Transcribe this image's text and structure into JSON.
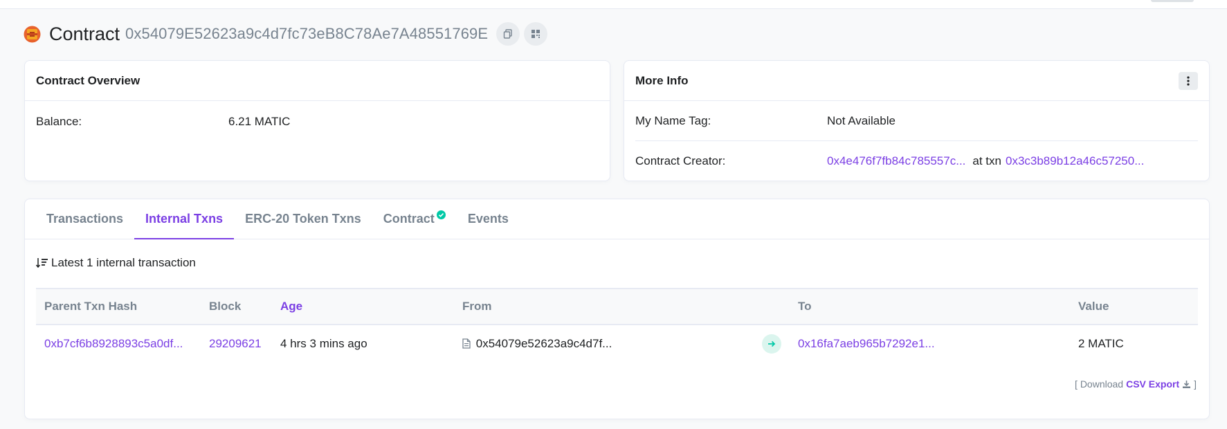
{
  "header": {
    "title": "Contract",
    "address": "0x54079E52623a9c4d7fc73eB8C78Ae7A48551769E"
  },
  "overview": {
    "title": "Contract Overview",
    "balance_label": "Balance:",
    "balance_value": "6.21 MATIC"
  },
  "more_info": {
    "title": "More Info",
    "name_tag_label": "My Name Tag:",
    "name_tag_value": "Not Available",
    "creator_label": "Contract Creator:",
    "creator_address": "0x4e476f7fb84c785557c...",
    "at_txn_label": "at txn",
    "creator_txn": "0x3c3b89b12a46c57250..."
  },
  "tabs": [
    {
      "label": "Transactions",
      "active": false
    },
    {
      "label": "Internal Txns",
      "active": true
    },
    {
      "label": "ERC-20 Token Txns",
      "active": false
    },
    {
      "label": "Contract",
      "active": false,
      "verified": true
    },
    {
      "label": "Events",
      "active": false
    }
  ],
  "internal_txns": {
    "summary": "Latest 1 internal transaction",
    "columns": [
      "Parent Txn Hash",
      "Block",
      "Age",
      "From",
      "To",
      "Value"
    ],
    "rows": [
      {
        "parent_hash": "0xb7cf6b8928893c5a0df...",
        "block": "29209621",
        "age": "4 hrs 3 mins ago",
        "from": "0x54079e52623a9c4d7f...",
        "to": "0x16fa7aeb965b7292e1...",
        "value": "2 MATIC"
      }
    ],
    "download_prefix": "[ Download",
    "csv_label": "CSV Export",
    "download_suffix": "]"
  },
  "colors": {
    "accent": "#7b3fe4",
    "muted": "#77838f",
    "success": "#00c9a7"
  },
  "icons": {
    "logo": "contract-token-icon",
    "copy": "copy-icon",
    "qr": "qr-code-icon",
    "kebab": "kebab-menu-icon",
    "verified": "check-circle-icon",
    "sort": "sort-descending-icon",
    "file": "file-icon",
    "arrow": "arrow-right-icon",
    "download": "download-icon"
  }
}
